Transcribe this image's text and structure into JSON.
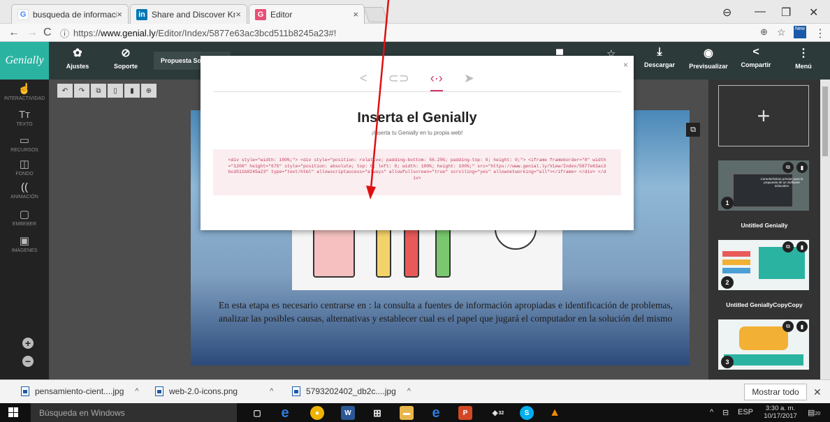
{
  "browser": {
    "tabs": [
      {
        "label": "busqueda de informacio",
        "favicon": "G",
        "color": "#4285f4"
      },
      {
        "label": "Share and Discover Know",
        "favicon": "in",
        "color": "#0077b5"
      },
      {
        "label": "Editor",
        "favicon": "G",
        "color": "#e94e77"
      }
    ],
    "url_prefix": "https://",
    "url_host": "www.genial.ly",
    "url_path": "/Editor/Index/5877e63ac3bcd511b8245a23#!",
    "ext_badge": "New"
  },
  "app": {
    "brand": "Genially",
    "project_name": "Propuesta Sof",
    "top_buttons": [
      {
        "label": "Ajustes",
        "icon": "gear-icon"
      },
      {
        "label": "Soporte",
        "icon": "help-icon"
      },
      {
        "label": "Descargar",
        "icon": "download-icon"
      },
      {
        "label": "Previsualizar",
        "icon": "eye-icon"
      },
      {
        "label": "Compartir",
        "icon": "share-icon"
      },
      {
        "label": "Menú",
        "icon": "more-icon"
      }
    ],
    "left_tools": [
      {
        "label": "INTERACTIVIDAD",
        "icon": "hand-icon"
      },
      {
        "label": "TEXTO",
        "icon": "text-icon"
      },
      {
        "label": "RECURSOS",
        "icon": "resources-icon"
      },
      {
        "label": "FONDO",
        "icon": "background-icon"
      },
      {
        "label": "ANIMACIÓN",
        "icon": "animation-icon"
      },
      {
        "label": "EMBEBER",
        "icon": "embed-icon"
      },
      {
        "label": "IMÁGENES",
        "icon": "image-icon"
      }
    ]
  },
  "slide": {
    "body_text": "En esta etapa es necesario centrarse en : la consulta a fuentes de información apropiadas e identificación de problemas, analizar las posibles causas, alternativas y establecer cual es el papel que jugará el computador en la solución del mismo"
  },
  "modal": {
    "title": "Inserta el Genially",
    "subtitle": "¡Inserta tu Genially en tu propia web!",
    "embed_code": "<div style=\"width: 100%;\"> <div style=\"position: relative; padding-bottom: 56.25%; padding-top: 0; height: 0;\"> <iframe frameborder=\"0\" width=\"1200\" height=\"675\" style=\"position: absolute; top: 0; left: 0; width: 100%; height: 100%;\" src=\"https://www.genial.ly/View/Index/5877e63ac3bcd511b8245a23\" type=\"text/html\" allowscriptaccess=\"always\" allowfullscreen=\"true\" scrolling=\"yes\" allownetworking=\"all\"></iframe> </div> </div>",
    "accent": "#d6336c"
  },
  "thumbnails": [
    {
      "number": "1",
      "label": "Untitled Genially",
      "thumb_text": "Características previas para la propuesta de un Software Educativo"
    },
    {
      "number": "2",
      "label": "Untitled GeniallyCopyCopy"
    },
    {
      "number": "3",
      "label": ""
    }
  ],
  "downloads": {
    "items": [
      {
        "name": "pensamiento-cient....jpg"
      },
      {
        "name": "web-2.0-icons.png"
      },
      {
        "name": "5793202402_db2c....jpg"
      }
    ],
    "show_all": "Mostrar todo"
  },
  "taskbar": {
    "search_placeholder": "Búsqueda en Windows",
    "lang": "ESP",
    "time": "3:30 a. m.",
    "date": "10/17/2017",
    "notif_count": "20",
    "app_badge": "32"
  }
}
